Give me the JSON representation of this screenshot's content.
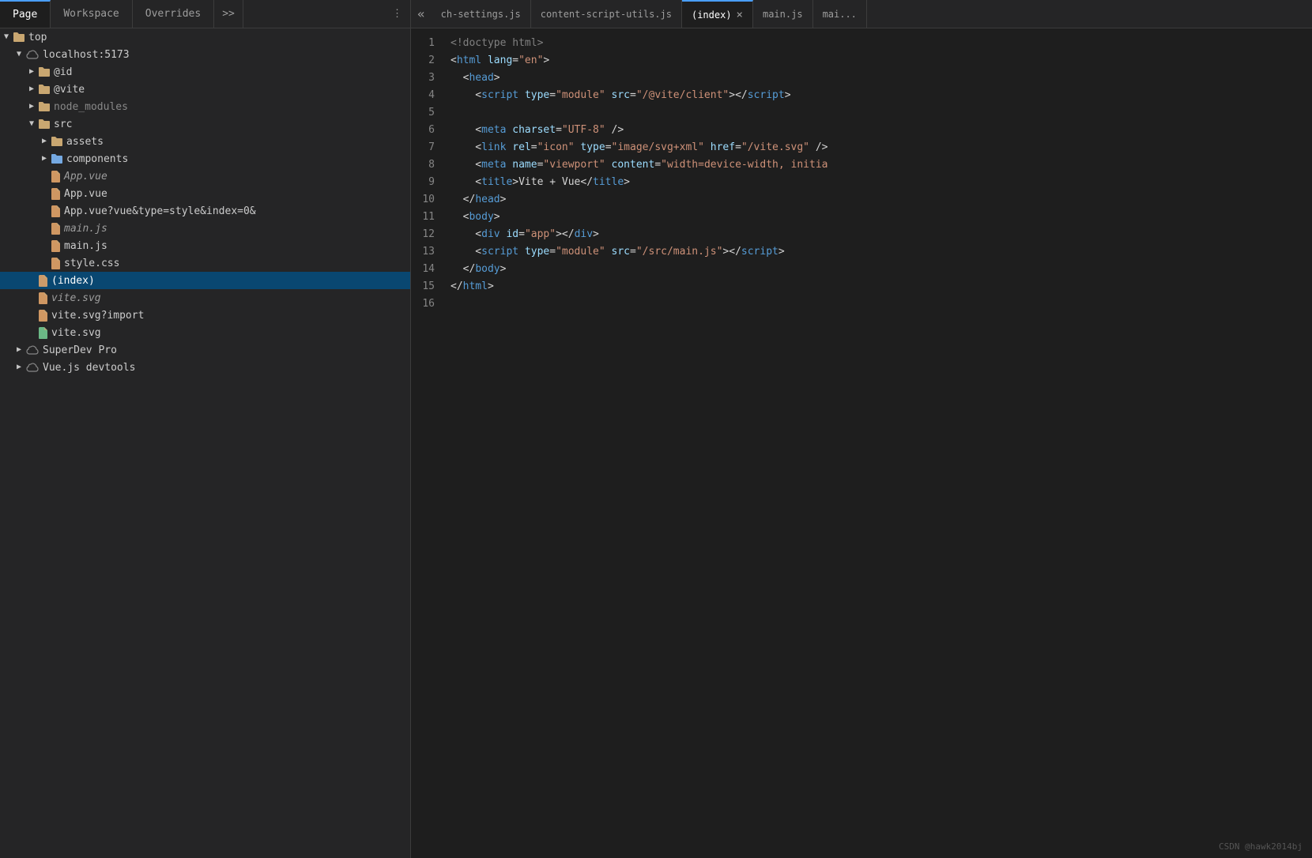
{
  "topTabs": {
    "left": [
      {
        "label": "Page",
        "active": true
      },
      {
        "label": "Workspace",
        "active": false
      },
      {
        "label": "Overrides",
        "active": false
      }
    ],
    "moreLabel": ">>",
    "kebabLabel": "⋮"
  },
  "editorTabs": [
    {
      "label": "ch-settings.js",
      "active": false,
      "closeable": false
    },
    {
      "label": "content-script-utils.js",
      "active": false,
      "closeable": false
    },
    {
      "label": "(index)",
      "active": true,
      "closeable": true
    },
    {
      "label": "main.js",
      "active": false,
      "closeable": false
    },
    {
      "label": "mai...",
      "active": false,
      "closeable": false
    }
  ],
  "collapseIcon": "«",
  "sidebar": {
    "items": [
      {
        "id": "top",
        "label": "top",
        "indent": 0,
        "type": "root",
        "expanded": true,
        "chevron": "▼"
      },
      {
        "id": "localhost",
        "label": "localhost:5173",
        "indent": 1,
        "type": "cloud",
        "expanded": true,
        "chevron": "▼"
      },
      {
        "id": "id",
        "label": "@id",
        "indent": 2,
        "type": "folder",
        "expanded": false,
        "chevron": "▶"
      },
      {
        "id": "vite",
        "label": "@vite",
        "indent": 2,
        "type": "folder",
        "expanded": false,
        "chevron": "▶"
      },
      {
        "id": "node_modules",
        "label": "node_modules",
        "indent": 2,
        "type": "folder",
        "expanded": false,
        "chevron": "▶",
        "dimmed": true
      },
      {
        "id": "src",
        "label": "src",
        "indent": 2,
        "type": "folder",
        "expanded": true,
        "chevron": "▼"
      },
      {
        "id": "assets",
        "label": "assets",
        "indent": 3,
        "type": "folder",
        "expanded": false,
        "chevron": "▶"
      },
      {
        "id": "components",
        "label": "components",
        "indent": 3,
        "type": "folder",
        "expanded": false,
        "chevron": "▶",
        "selected": false,
        "highlighted": true
      },
      {
        "id": "app-vue-italic",
        "label": "App.vue",
        "indent": 3,
        "type": "file",
        "italic": true
      },
      {
        "id": "app-vue",
        "label": "App.vue",
        "indent": 3,
        "type": "file"
      },
      {
        "id": "app-vue-query",
        "label": "App.vue?vue&type=style&index=0&",
        "indent": 3,
        "type": "file"
      },
      {
        "id": "main-js-italic",
        "label": "main.js",
        "indent": 3,
        "type": "file",
        "italic": true
      },
      {
        "id": "main-js",
        "label": "main.js",
        "indent": 3,
        "type": "file"
      },
      {
        "id": "style-css",
        "label": "style.css",
        "indent": 3,
        "type": "file"
      },
      {
        "id": "index",
        "label": "(index)",
        "indent": 2,
        "type": "file",
        "selected": true
      },
      {
        "id": "vite-svg-italic",
        "label": "vite.svg",
        "indent": 2,
        "type": "file",
        "italic": true
      },
      {
        "id": "vite-svg-import",
        "label": "vite.svg?import",
        "indent": 2,
        "type": "file"
      },
      {
        "id": "vite-svg-green",
        "label": "vite.svg",
        "indent": 2,
        "type": "file",
        "green": true
      },
      {
        "id": "superdev",
        "label": "SuperDev Pro",
        "indent": 1,
        "type": "cloud",
        "expanded": false,
        "chevron": "▶"
      },
      {
        "id": "vuejs",
        "label": "Vue.js devtools",
        "indent": 1,
        "type": "cloud",
        "expanded": false,
        "chevron": "▶"
      }
    ]
  },
  "codeLines": [
    {
      "num": 1,
      "tokens": [
        {
          "text": "<!doctype html>",
          "class": "c-gray"
        }
      ]
    },
    {
      "num": 2,
      "tokens": [
        {
          "text": "<",
          "class": "c-white"
        },
        {
          "text": "html",
          "class": "c-blue"
        },
        {
          "text": " ",
          "class": "c-white"
        },
        {
          "text": "lang",
          "class": "c-lt-blue"
        },
        {
          "text": "=",
          "class": "c-white"
        },
        {
          "text": "\"en\"",
          "class": "c-orange"
        },
        {
          "text": ">",
          "class": "c-white"
        }
      ]
    },
    {
      "num": 3,
      "tokens": [
        {
          "text": "  <",
          "class": "c-white"
        },
        {
          "text": "head",
          "class": "c-blue"
        },
        {
          "text": ">",
          "class": "c-white"
        }
      ]
    },
    {
      "num": 4,
      "tokens": [
        {
          "text": "    <",
          "class": "c-white"
        },
        {
          "text": "script",
          "class": "c-blue"
        },
        {
          "text": " ",
          "class": "c-white"
        },
        {
          "text": "type",
          "class": "c-lt-blue"
        },
        {
          "text": "=",
          "class": "c-white"
        },
        {
          "text": "\"module\"",
          "class": "c-orange"
        },
        {
          "text": " ",
          "class": "c-white"
        },
        {
          "text": "src",
          "class": "c-lt-blue"
        },
        {
          "text": "=",
          "class": "c-white"
        },
        {
          "text": "\"/@vite/client\"",
          "class": "c-orange"
        },
        {
          "text": "></",
          "class": "c-white"
        },
        {
          "text": "script",
          "class": "c-blue"
        },
        {
          "text": ">",
          "class": "c-white"
        }
      ]
    },
    {
      "num": 5,
      "tokens": []
    },
    {
      "num": 6,
      "tokens": [
        {
          "text": "    <",
          "class": "c-white"
        },
        {
          "text": "meta",
          "class": "c-blue"
        },
        {
          "text": " ",
          "class": "c-white"
        },
        {
          "text": "charset",
          "class": "c-lt-blue"
        },
        {
          "text": "=",
          "class": "c-white"
        },
        {
          "text": "\"UTF-8\"",
          "class": "c-orange"
        },
        {
          "text": " />",
          "class": "c-white"
        }
      ]
    },
    {
      "num": 7,
      "tokens": [
        {
          "text": "    <",
          "class": "c-white"
        },
        {
          "text": "link",
          "class": "c-blue"
        },
        {
          "text": " ",
          "class": "c-white"
        },
        {
          "text": "rel",
          "class": "c-lt-blue"
        },
        {
          "text": "=",
          "class": "c-white"
        },
        {
          "text": "\"icon\"",
          "class": "c-orange"
        },
        {
          "text": " ",
          "class": "c-white"
        },
        {
          "text": "type",
          "class": "c-lt-blue"
        },
        {
          "text": "=",
          "class": "c-white"
        },
        {
          "text": "\"image/svg+xml\"",
          "class": "c-orange"
        },
        {
          "text": " ",
          "class": "c-white"
        },
        {
          "text": "href",
          "class": "c-lt-blue"
        },
        {
          "text": "=",
          "class": "c-white"
        },
        {
          "text": "\"/vite.svg\"",
          "class": "c-orange"
        },
        {
          "text": " />",
          "class": "c-white"
        }
      ]
    },
    {
      "num": 8,
      "tokens": [
        {
          "text": "    <",
          "class": "c-white"
        },
        {
          "text": "meta",
          "class": "c-blue"
        },
        {
          "text": " ",
          "class": "c-white"
        },
        {
          "text": "name",
          "class": "c-lt-blue"
        },
        {
          "text": "=",
          "class": "c-white"
        },
        {
          "text": "\"viewport\"",
          "class": "c-orange"
        },
        {
          "text": " ",
          "class": "c-white"
        },
        {
          "text": "content",
          "class": "c-lt-blue"
        },
        {
          "text": "=",
          "class": "c-white"
        },
        {
          "text": "\"width=device-width, initia",
          "class": "c-orange"
        }
      ]
    },
    {
      "num": 9,
      "tokens": [
        {
          "text": "    <",
          "class": "c-white"
        },
        {
          "text": "title",
          "class": "c-blue"
        },
        {
          "text": ">Vite + Vue</",
          "class": "c-white"
        },
        {
          "text": "title",
          "class": "c-blue"
        },
        {
          "text": ">",
          "class": "c-white"
        }
      ]
    },
    {
      "num": 10,
      "tokens": [
        {
          "text": "  </",
          "class": "c-white"
        },
        {
          "text": "head",
          "class": "c-blue"
        },
        {
          "text": ">",
          "class": "c-white"
        }
      ]
    },
    {
      "num": 11,
      "tokens": [
        {
          "text": "  <",
          "class": "c-white"
        },
        {
          "text": "body",
          "class": "c-blue"
        },
        {
          "text": ">",
          "class": "c-white"
        }
      ]
    },
    {
      "num": 12,
      "tokens": [
        {
          "text": "    <",
          "class": "c-white"
        },
        {
          "text": "div",
          "class": "c-blue"
        },
        {
          "text": " ",
          "class": "c-white"
        },
        {
          "text": "id",
          "class": "c-lt-blue"
        },
        {
          "text": "=",
          "class": "c-white"
        },
        {
          "text": "\"app\"",
          "class": "c-orange"
        },
        {
          "text": "></",
          "class": "c-white"
        },
        {
          "text": "div",
          "class": "c-blue"
        },
        {
          "text": ">",
          "class": "c-white"
        }
      ]
    },
    {
      "num": 13,
      "tokens": [
        {
          "text": "    <",
          "class": "c-white"
        },
        {
          "text": "script",
          "class": "c-blue"
        },
        {
          "text": " ",
          "class": "c-white"
        },
        {
          "text": "type",
          "class": "c-lt-blue"
        },
        {
          "text": "=",
          "class": "c-white"
        },
        {
          "text": "\"module\"",
          "class": "c-orange"
        },
        {
          "text": " ",
          "class": "c-white"
        },
        {
          "text": "src",
          "class": "c-lt-blue"
        },
        {
          "text": "=",
          "class": "c-white"
        },
        {
          "text": "\"/src/main.js\"",
          "class": "c-orange"
        },
        {
          "text": "></",
          "class": "c-white"
        },
        {
          "text": "script",
          "class": "c-blue"
        },
        {
          "text": ">",
          "class": "c-white"
        }
      ]
    },
    {
      "num": 14,
      "tokens": [
        {
          "text": "  </",
          "class": "c-white"
        },
        {
          "text": "body",
          "class": "c-blue"
        },
        {
          "text": ">",
          "class": "c-white"
        }
      ]
    },
    {
      "num": 15,
      "tokens": [
        {
          "text": "</",
          "class": "c-white"
        },
        {
          "text": "html",
          "class": "c-blue"
        },
        {
          "text": ">",
          "class": "c-white"
        }
      ]
    },
    {
      "num": 16,
      "tokens": []
    }
  ],
  "watermark": "CSDN @hawk2014bj"
}
